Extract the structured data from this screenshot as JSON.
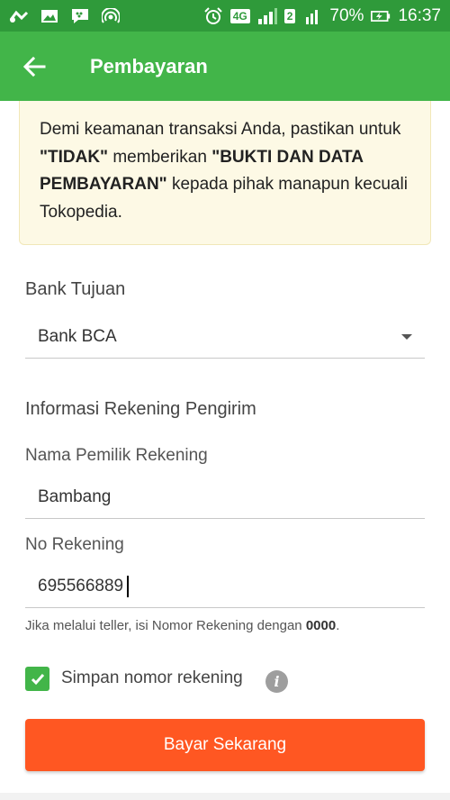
{
  "status_bar": {
    "battery": "70%",
    "time": "16:37",
    "network": "4G",
    "sim_slot": "2"
  },
  "header": {
    "title": "Pembayaran"
  },
  "notice": {
    "part1": "Demi keamanan transaksi Anda, pastikan untuk ",
    "bold1": "\"TIDAK\"",
    "part2": " memberikan ",
    "bold2": "\"BUKTI DAN DATA PEMBAYARAN\"",
    "part3": " kepada pihak manapun kecuali Tokopedia."
  },
  "bank": {
    "label": "Bank Tujuan",
    "selected": "Bank BCA"
  },
  "sender": {
    "section_title": "Informasi Rekening Pengirim",
    "name_label": "Nama Pemilik Rekening",
    "name_value": "Bambang",
    "account_label": "No Rekening",
    "account_value": "695566889",
    "hint_text": "Jika melalui teller, isi Nomor Rekening dengan ",
    "hint_bold": "0000",
    "hint_end": "."
  },
  "save_option": {
    "label": "Simpan nomor rekening",
    "checked": true
  },
  "pay_button": {
    "label": "Bayar Sekarang"
  },
  "colors": {
    "primary_green": "#42b549",
    "status_green": "#2f9a3a",
    "action_orange": "#ff5722",
    "notice_bg": "#fdf9e5"
  }
}
